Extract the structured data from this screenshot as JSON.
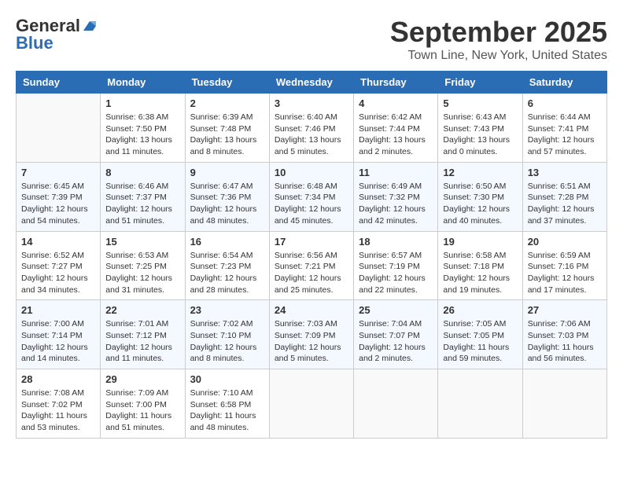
{
  "logo": {
    "line1": "General",
    "line2": "Blue"
  },
  "title": "September 2025",
  "location": "Town Line, New York, United States",
  "weekdays": [
    "Sunday",
    "Monday",
    "Tuesday",
    "Wednesday",
    "Thursday",
    "Friday",
    "Saturday"
  ],
  "weeks": [
    [
      {
        "day": "",
        "info": ""
      },
      {
        "day": "1",
        "info": "Sunrise: 6:38 AM\nSunset: 7:50 PM\nDaylight: 13 hours\nand 11 minutes."
      },
      {
        "day": "2",
        "info": "Sunrise: 6:39 AM\nSunset: 7:48 PM\nDaylight: 13 hours\nand 8 minutes."
      },
      {
        "day": "3",
        "info": "Sunrise: 6:40 AM\nSunset: 7:46 PM\nDaylight: 13 hours\nand 5 minutes."
      },
      {
        "day": "4",
        "info": "Sunrise: 6:42 AM\nSunset: 7:44 PM\nDaylight: 13 hours\nand 2 minutes."
      },
      {
        "day": "5",
        "info": "Sunrise: 6:43 AM\nSunset: 7:43 PM\nDaylight: 13 hours\nand 0 minutes."
      },
      {
        "day": "6",
        "info": "Sunrise: 6:44 AM\nSunset: 7:41 PM\nDaylight: 12 hours\nand 57 minutes."
      }
    ],
    [
      {
        "day": "7",
        "info": "Sunrise: 6:45 AM\nSunset: 7:39 PM\nDaylight: 12 hours\nand 54 minutes."
      },
      {
        "day": "8",
        "info": "Sunrise: 6:46 AM\nSunset: 7:37 PM\nDaylight: 12 hours\nand 51 minutes."
      },
      {
        "day": "9",
        "info": "Sunrise: 6:47 AM\nSunset: 7:36 PM\nDaylight: 12 hours\nand 48 minutes."
      },
      {
        "day": "10",
        "info": "Sunrise: 6:48 AM\nSunset: 7:34 PM\nDaylight: 12 hours\nand 45 minutes."
      },
      {
        "day": "11",
        "info": "Sunrise: 6:49 AM\nSunset: 7:32 PM\nDaylight: 12 hours\nand 42 minutes."
      },
      {
        "day": "12",
        "info": "Sunrise: 6:50 AM\nSunset: 7:30 PM\nDaylight: 12 hours\nand 40 minutes."
      },
      {
        "day": "13",
        "info": "Sunrise: 6:51 AM\nSunset: 7:28 PM\nDaylight: 12 hours\nand 37 minutes."
      }
    ],
    [
      {
        "day": "14",
        "info": "Sunrise: 6:52 AM\nSunset: 7:27 PM\nDaylight: 12 hours\nand 34 minutes."
      },
      {
        "day": "15",
        "info": "Sunrise: 6:53 AM\nSunset: 7:25 PM\nDaylight: 12 hours\nand 31 minutes."
      },
      {
        "day": "16",
        "info": "Sunrise: 6:54 AM\nSunset: 7:23 PM\nDaylight: 12 hours\nand 28 minutes."
      },
      {
        "day": "17",
        "info": "Sunrise: 6:56 AM\nSunset: 7:21 PM\nDaylight: 12 hours\nand 25 minutes."
      },
      {
        "day": "18",
        "info": "Sunrise: 6:57 AM\nSunset: 7:19 PM\nDaylight: 12 hours\nand 22 minutes."
      },
      {
        "day": "19",
        "info": "Sunrise: 6:58 AM\nSunset: 7:18 PM\nDaylight: 12 hours\nand 19 minutes."
      },
      {
        "day": "20",
        "info": "Sunrise: 6:59 AM\nSunset: 7:16 PM\nDaylight: 12 hours\nand 17 minutes."
      }
    ],
    [
      {
        "day": "21",
        "info": "Sunrise: 7:00 AM\nSunset: 7:14 PM\nDaylight: 12 hours\nand 14 minutes."
      },
      {
        "day": "22",
        "info": "Sunrise: 7:01 AM\nSunset: 7:12 PM\nDaylight: 12 hours\nand 11 minutes."
      },
      {
        "day": "23",
        "info": "Sunrise: 7:02 AM\nSunset: 7:10 PM\nDaylight: 12 hours\nand 8 minutes."
      },
      {
        "day": "24",
        "info": "Sunrise: 7:03 AM\nSunset: 7:09 PM\nDaylight: 12 hours\nand 5 minutes."
      },
      {
        "day": "25",
        "info": "Sunrise: 7:04 AM\nSunset: 7:07 PM\nDaylight: 12 hours\nand 2 minutes."
      },
      {
        "day": "26",
        "info": "Sunrise: 7:05 AM\nSunset: 7:05 PM\nDaylight: 11 hours\nand 59 minutes."
      },
      {
        "day": "27",
        "info": "Sunrise: 7:06 AM\nSunset: 7:03 PM\nDaylight: 11 hours\nand 56 minutes."
      }
    ],
    [
      {
        "day": "28",
        "info": "Sunrise: 7:08 AM\nSunset: 7:02 PM\nDaylight: 11 hours\nand 53 minutes."
      },
      {
        "day": "29",
        "info": "Sunrise: 7:09 AM\nSunset: 7:00 PM\nDaylight: 11 hours\nand 51 minutes."
      },
      {
        "day": "30",
        "info": "Sunrise: 7:10 AM\nSunset: 6:58 PM\nDaylight: 11 hours\nand 48 minutes."
      },
      {
        "day": "",
        "info": ""
      },
      {
        "day": "",
        "info": ""
      },
      {
        "day": "",
        "info": ""
      },
      {
        "day": "",
        "info": ""
      }
    ]
  ]
}
